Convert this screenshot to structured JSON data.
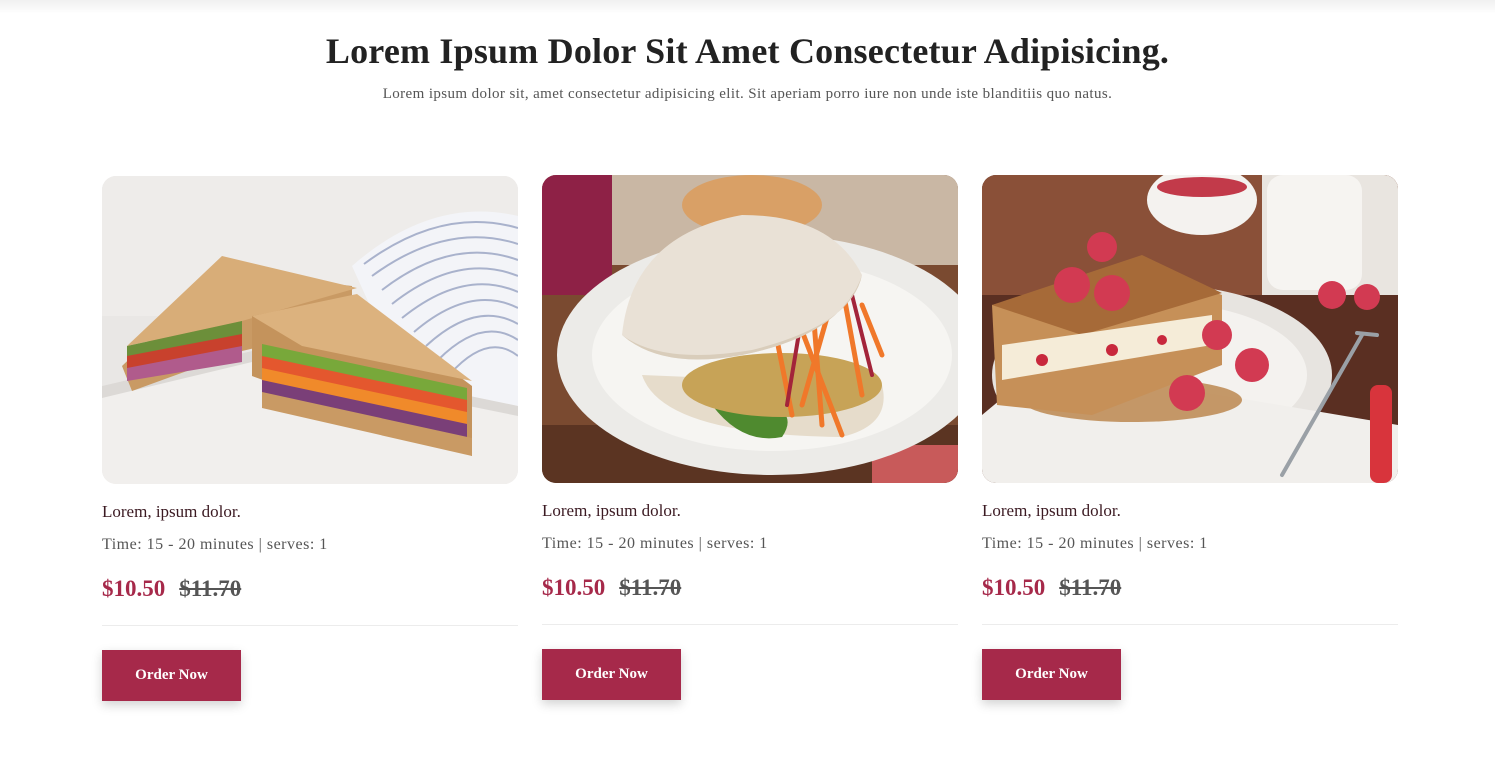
{
  "header": {
    "title": "Lorem Ipsum Dolor Sit Amet Consectetur Adipisicing.",
    "subtitle": "Lorem ipsum dolor sit, amet consectetur adipisicing elit. Sit aperiam porro iure non unde iste blanditiis quo natus."
  },
  "cards": [
    {
      "name": "Lorem, ipsum dolor.",
      "meta": "Time: 15 - 20 minutes | serves: 1",
      "price": "$10.50",
      "old_price": "$11.70",
      "button": "Order Now",
      "image": "veggie-sandwich-photo"
    },
    {
      "name": "Lorem, ipsum dolor.",
      "meta": "Time: 15 - 20 minutes | serves: 1",
      "price": "$10.50",
      "old_price": "$11.70",
      "button": "Order Now",
      "image": "chicken-ciabatta-photo"
    },
    {
      "name": "Lorem, ipsum dolor.",
      "meta": "Time: 15 - 20 minutes | serves: 1",
      "price": "$10.50",
      "old_price": "$11.70",
      "button": "Order Now",
      "image": "raspberry-french-toast-photo"
    }
  ],
  "colors": {
    "accent": "#a6294a",
    "text": "#222222",
    "muted": "#555555"
  }
}
